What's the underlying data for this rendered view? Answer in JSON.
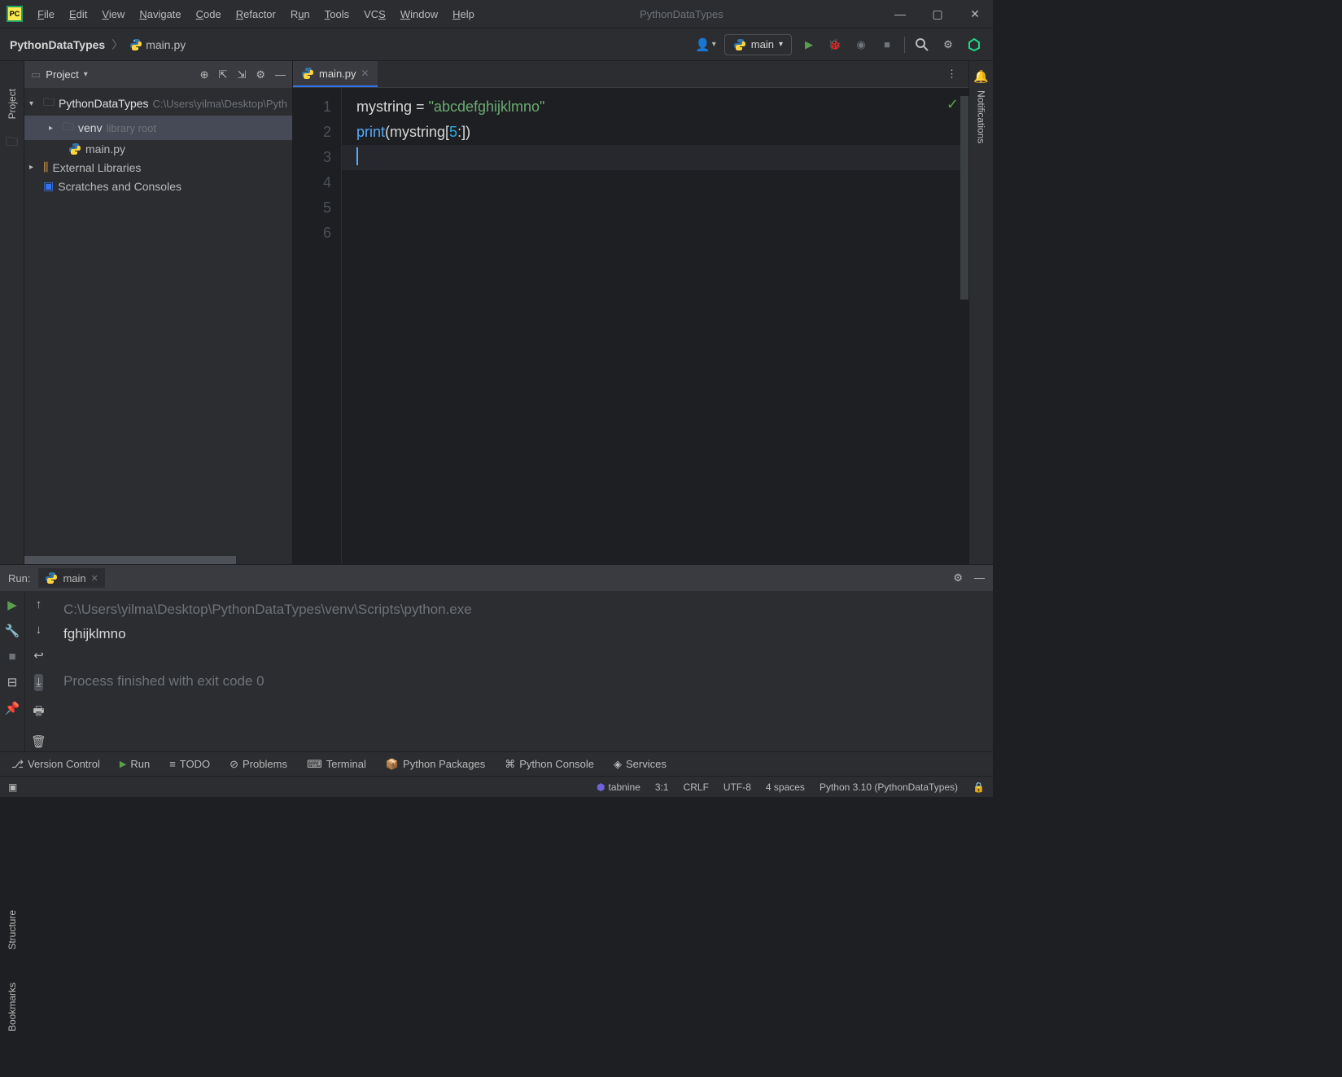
{
  "titlebar": {
    "app_name": "PythonDataTypes",
    "menu": [
      "File",
      "Edit",
      "View",
      "Navigate",
      "Code",
      "Refactor",
      "Run",
      "Tools",
      "VCS",
      "Window",
      "Help"
    ]
  },
  "toolbar": {
    "breadcrumb_project": "PythonDataTypes",
    "breadcrumb_file": "main.py",
    "run_config": "main"
  },
  "project": {
    "header": "Project",
    "root_name": "PythonDataTypes",
    "root_path": "C:\\Users\\yilma\\Desktop\\Pyth",
    "venv": "venv",
    "venv_note": "library root",
    "file": "main.py",
    "ext_lib": "External Libraries",
    "scratches": "Scratches and Consoles"
  },
  "editor": {
    "tab": "main.py",
    "lines": {
      "1": {
        "var": "mystring",
        "op": "=",
        "str": "\"abcdefghijklmno\""
      },
      "2": {
        "fn": "print",
        "var": "mystring",
        "idx": "5"
      }
    },
    "line_numbers": [
      "1",
      "2",
      "3",
      "4",
      "5",
      "6"
    ]
  },
  "run": {
    "label": "Run:",
    "tab": "main",
    "path": "C:\\Users\\yilma\\Desktop\\PythonDataTypes\\venv\\Scripts\\python.exe",
    "output": "fghijklmno",
    "exit": "Process finished with exit code 0"
  },
  "bottom": {
    "version_control": "Version Control",
    "run": "Run",
    "todo": "TODO",
    "problems": "Problems",
    "terminal": "Terminal",
    "packages": "Python Packages",
    "console": "Python Console",
    "services": "Services"
  },
  "status": {
    "tabnine": "tabnine",
    "pos": "3:1",
    "eol": "CRLF",
    "encoding": "UTF-8",
    "indent": "4 spaces",
    "interpreter": "Python 3.10 (PythonDataTypes)"
  },
  "left_rail": {
    "project": "Project",
    "structure": "Structure",
    "bookmarks": "Bookmarks"
  },
  "right_rail": {
    "notifications": "Notifications"
  }
}
